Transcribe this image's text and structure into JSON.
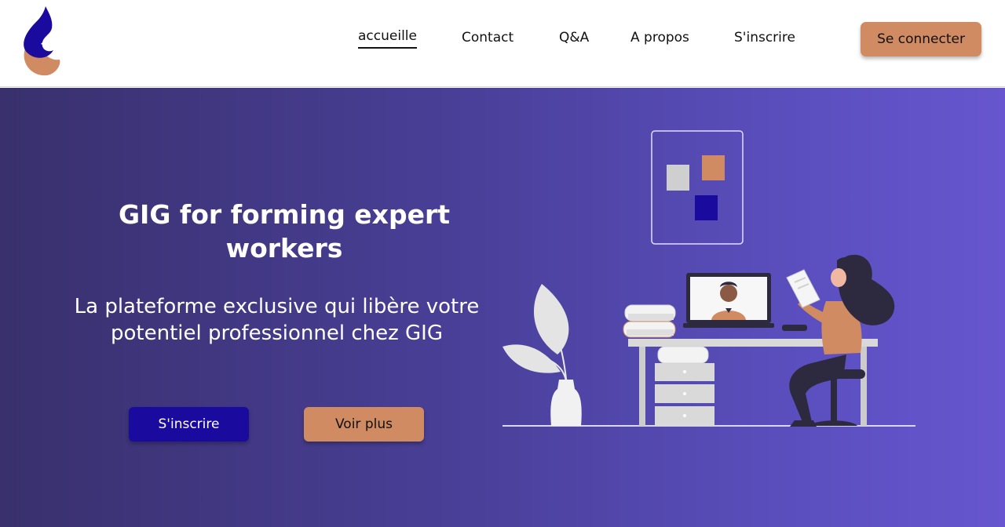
{
  "nav": {
    "links": [
      {
        "label": "accueille",
        "active": true
      },
      {
        "label": "Contact",
        "active": false
      },
      {
        "label": "Q&A",
        "active": false
      },
      {
        "label": "A propos",
        "active": false
      },
      {
        "label": "S'inscrire",
        "active": false
      }
    ],
    "login_label": "Se connecter"
  },
  "hero": {
    "title": "GIG for forming expert workers",
    "subtitle": "La plateforme exclusive qui libère votre potentiel professionnel chez GIG",
    "signup_label": "S'inscrire",
    "more_label": "Voir plus"
  },
  "colors": {
    "brand_blue": "#1b0a9e",
    "accent_orange": "#d08b62",
    "hero_gradient_start": "#39306d",
    "hero_gradient_end": "#6756cf"
  },
  "icons": {
    "logo": "droplet-logo",
    "illustration": "woman-at-desk-video-call"
  }
}
